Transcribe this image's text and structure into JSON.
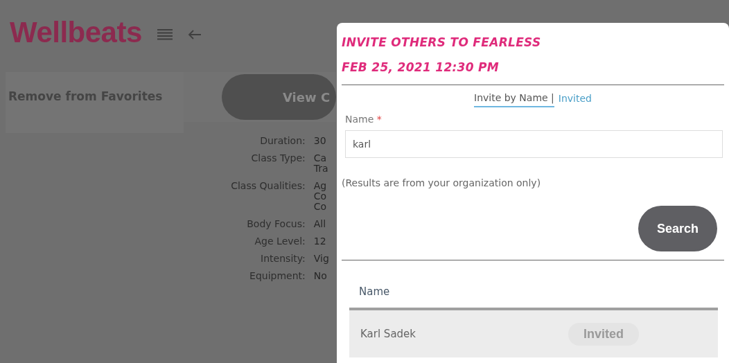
{
  "header": {
    "logo": "Wellbeats"
  },
  "actions": {
    "favorite_button": "Remove from Favorites",
    "view_button": "View C"
  },
  "details": [
    {
      "label": "Duration:",
      "lines": [
        "30"
      ]
    },
    {
      "label": "Class Type:",
      "lines": [
        "Ca",
        "Tra"
      ]
    },
    {
      "label": "Class Qualities:",
      "lines": [
        "Ag",
        "Co",
        "Co"
      ]
    },
    {
      "label": "Body Focus:",
      "lines": [
        "All"
      ]
    },
    {
      "label": "Age Level:",
      "lines": [
        "12"
      ]
    },
    {
      "label": "Intensity:",
      "lines": [
        "Vig"
      ]
    },
    {
      "label": "Equipment:",
      "lines": [
        "No"
      ]
    }
  ],
  "modal": {
    "title": "INVITE OTHERS TO FEARLESS",
    "date": "FEB 25, 2021 12:30 PM",
    "tabs": [
      {
        "label": "Invite by Name |",
        "selected": true
      },
      {
        "label": "Invited",
        "selected": false
      }
    ],
    "field": {
      "label": "Name",
      "required_mark": "*",
      "value": "karl"
    },
    "note": "(Results are from your organization only)",
    "search_button": "Search",
    "table": {
      "columns": [
        "Name"
      ],
      "rows": [
        {
          "name": "Karl Sadek",
          "status": "Invited",
          "disabled": true
        }
      ]
    }
  }
}
